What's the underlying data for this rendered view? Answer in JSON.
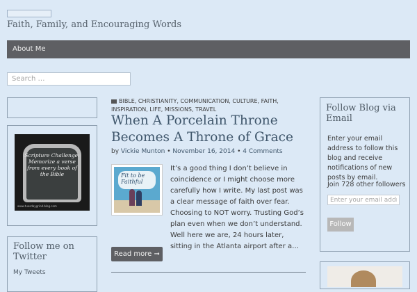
{
  "site": {
    "tagline": "Faith, Family, and Encouraging Words"
  },
  "nav": {
    "items": [
      {
        "label": "About Me"
      }
    ]
  },
  "search": {
    "placeholder": "Search …"
  },
  "sidebar_left": {
    "image_widget": {
      "chalkboard_text": "Scripture Challenge: Memorize a verse from every book of the Bible",
      "url_text": "www.tuesdaygrind.blog.com"
    },
    "twitter_widget": {
      "title": "Follow me on Twitter",
      "subtitle": "My Tweets"
    }
  },
  "post": {
    "categories_text": "BIBLE, CHRISTIANITY, COMMUNICATION, CULTURE, FAITH, INSPIRATION, LIFE, MISSIONS, TRAVEL",
    "title": "When A Porcelain Throne Becomes A Throne of Grace",
    "meta": {
      "by": "by",
      "author": "Vickie Munton",
      "separator": "•",
      "date": "November 16, 2014",
      "comments": "4 Comments"
    },
    "thumbnail": {
      "text": "Fit to be Faithful"
    },
    "excerpt": "It’s a good thing I don’t believe in coincidence or I might choose more carefully how I write. My last post was a clear message of faith over fear. Choosing to NOT worry.  Trusting God’s plan even when we don’t understand. Well here we are, 24 hours later, sitting in the Atlanta airport after a…",
    "read_more": "Read more ➞"
  },
  "sidebar_right": {
    "follow_widget": {
      "title": "Follow Blog via Email",
      "description": "Enter your email address to follow this blog and receive notifications of new posts by email.",
      "followers": "Join 728 other followers",
      "email_placeholder": "Enter your email address",
      "button": "Follow"
    }
  },
  "colors": {
    "background": "#dce9f6",
    "nav_bg": "#5e5f63",
    "link": "#3f566b",
    "button_gray": "#b8b8b8"
  }
}
